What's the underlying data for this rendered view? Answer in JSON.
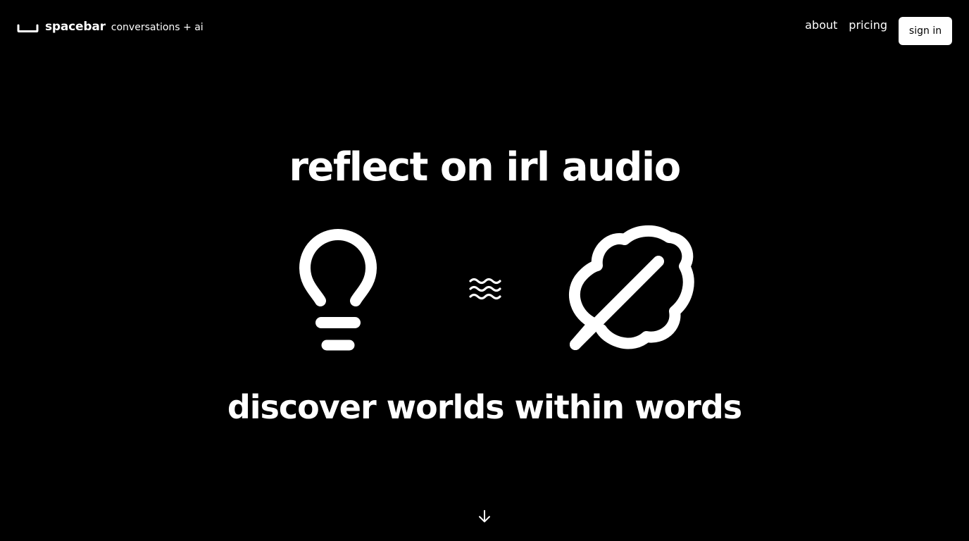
{
  "header": {
    "brand_name": "spacebar",
    "brand_tagline": "conversations + ai",
    "nav": {
      "about": "about",
      "pricing": "pricing",
      "sign_in": "sign in"
    }
  },
  "hero": {
    "title": "reflect on irl audio",
    "subtitle": "discover worlds within words",
    "icons": [
      "lightbulb-icon",
      "waves-icon",
      "leaf-icon"
    ]
  },
  "scroll_indicator": {
    "icon": "arrow-down-icon"
  },
  "colors": {
    "background": "#000000",
    "foreground": "#ffffff",
    "button_text": "#000000"
  }
}
